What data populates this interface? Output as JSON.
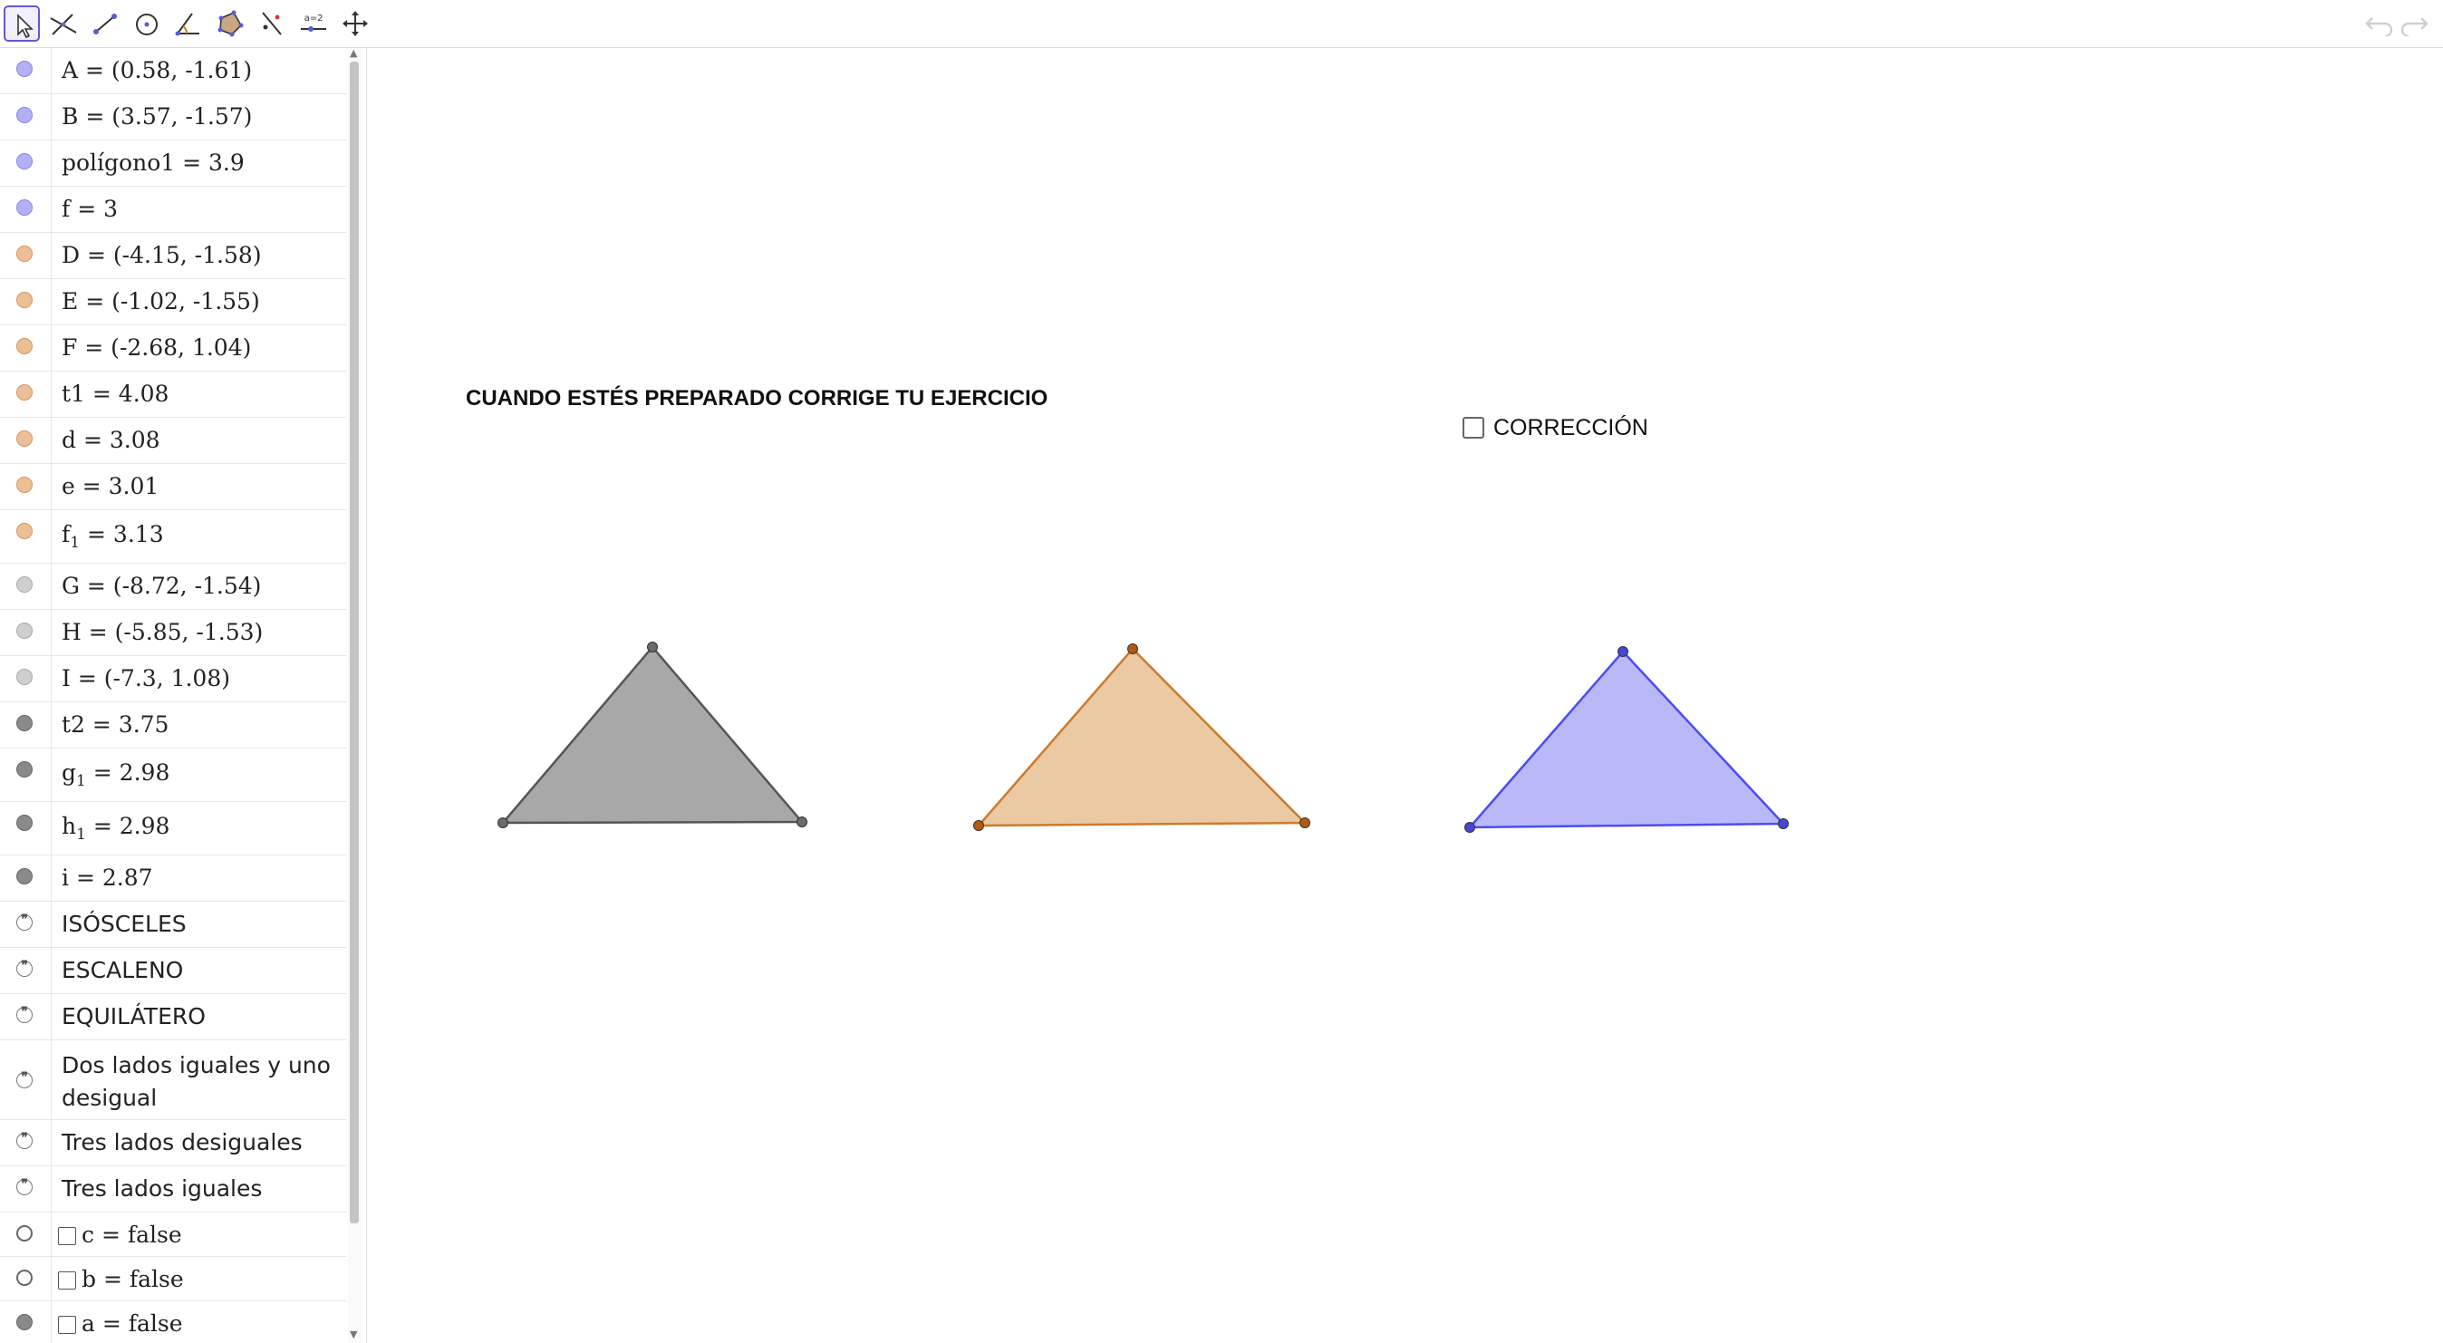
{
  "toolbar": {
    "tools": [
      "move-tool",
      "perpendicular-line-tool",
      "segment-tool",
      "circle-tool",
      "angle-tool",
      "polygon-tool",
      "reflect-tool",
      "slider-tool",
      "move-graphics-view-tool"
    ],
    "slider_tool_label": "a=2",
    "undo_icon": "undo-icon",
    "redo_icon": "redo-icon"
  },
  "algebra": {
    "rows": [
      {
        "marble": "blue",
        "text": "A = (0.58, -1.61)"
      },
      {
        "marble": "blue",
        "text": "B = (3.57, -1.57)"
      },
      {
        "marble": "blue",
        "text": "polígono1 = 3.9"
      },
      {
        "marble": "blue",
        "text": "f = 3"
      },
      {
        "marble": "orange",
        "text": "D = (-4.15, -1.58)"
      },
      {
        "marble": "orange",
        "text": "E = (-1.02, -1.55)"
      },
      {
        "marble": "orange",
        "text": "F = (-2.68, 1.04)"
      },
      {
        "marble": "orange",
        "text": "t1 = 4.08"
      },
      {
        "marble": "orange",
        "text": "d = 3.08"
      },
      {
        "marble": "orange",
        "text": "e = 3.01"
      },
      {
        "marble": "orange",
        "name": "f",
        "sub": "1",
        "value": " = 3.13"
      },
      {
        "marble": "gray",
        "text": "G = (-8.72, -1.54)"
      },
      {
        "marble": "gray",
        "text": "H = (-5.85, -1.53)"
      },
      {
        "marble": "gray",
        "text": "I = (-7.3, 1.08)"
      },
      {
        "marble": "dark",
        "text": "t2 = 3.75"
      },
      {
        "marble": "dark",
        "name": "g",
        "sub": "1",
        "value": " = 2.98"
      },
      {
        "marble": "dark",
        "name": "h",
        "sub": "1",
        "value": " = 2.98"
      },
      {
        "marble": "dark",
        "text": "i = 2.87"
      },
      {
        "marble": "quote",
        "text": "ISÓSCELES"
      },
      {
        "marble": "quote",
        "text": "ESCALENO"
      },
      {
        "marble": "quote",
        "text": "EQUILÁTERO"
      },
      {
        "marble": "quote",
        "text": "Dos lados iguales y uno desigual"
      },
      {
        "marble": "quote",
        "text": "Tres lados desiguales"
      },
      {
        "marble": "quote",
        "text": "Tres lados iguales"
      },
      {
        "marble": "empty",
        "text": "c = false"
      },
      {
        "marble": "empty",
        "text": "b = false"
      },
      {
        "marble": "dark",
        "text": "a = false"
      }
    ]
  },
  "graphics": {
    "instruction": "CUANDO ESTÉS PREPARADO CORRIGE TU EJERCICIO",
    "correction_label": "CORRECCIÓN",
    "correction_checked": false,
    "colors": {
      "gray_fill": "#a8a8a8",
      "gray_stroke": "#555555",
      "orange_fill": "#ebc9a3",
      "orange_stroke": "#cc7a2e",
      "orange_point": "#b25a10",
      "blue_fill": "#b9b9fa",
      "blue_stroke": "#4c4cf0",
      "blue_point": "#4646d8"
    }
  }
}
